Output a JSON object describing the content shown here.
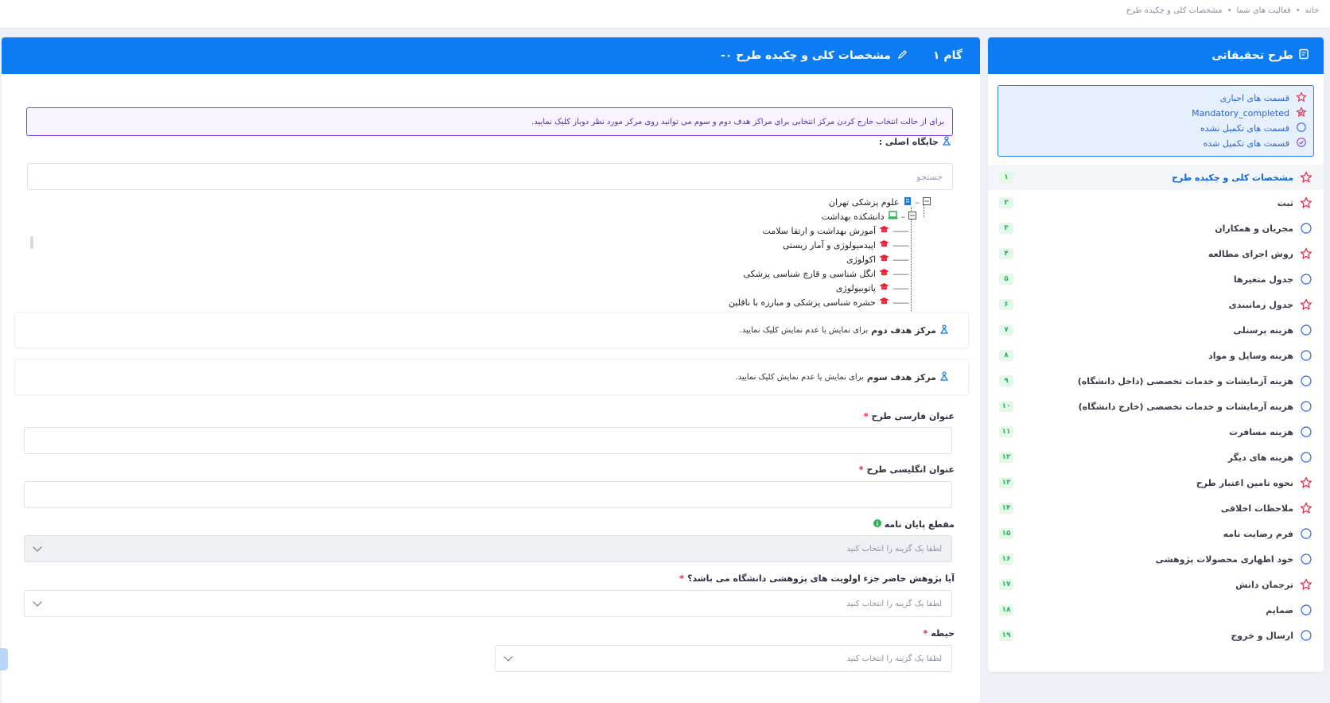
{
  "breadcrumb": [
    "خانه",
    "فعالیت های شما",
    "مشخصات کلی و چکیده طرح"
  ],
  "breadcrumb_sep": "•",
  "sidebar": {
    "title": "طرح تحقیقاتی",
    "legend": [
      {
        "icon": "star-outline-icon",
        "label": "قسمت های اجباری"
      },
      {
        "icon": "star-check-icon",
        "label": "Mandatory_completed"
      },
      {
        "icon": "circle-outline-icon",
        "label": "قسمت های تکمیل نشده"
      },
      {
        "icon": "circle-check-icon",
        "label": "قسمت های تکمیل شده"
      }
    ],
    "steps": [
      {
        "label": "مشخصات کلی و چکیده طرح",
        "num": "۱",
        "icon": "star"
      },
      {
        "label": "ثبت",
        "num": "۲",
        "icon": "star"
      },
      {
        "label": "مجریان و همکاران",
        "num": "۳",
        "icon": "circle"
      },
      {
        "label": "روش اجرای مطالعه",
        "num": "۴",
        "icon": "star"
      },
      {
        "label": "جدول متغیرها",
        "num": "۵",
        "icon": "circle"
      },
      {
        "label": "جدول زمانبندی",
        "num": "۶",
        "icon": "star"
      },
      {
        "label": "هزینه پرسنلی",
        "num": "۷",
        "icon": "circle"
      },
      {
        "label": "هزینه وسایل و مواد",
        "num": "۸",
        "icon": "circle"
      },
      {
        "label": "هزینه آزمایشات و خدمات تخصصی (داخل دانشگاه)",
        "num": "۹",
        "icon": "circle"
      },
      {
        "label": "هزینه آزمایشات و خدمات تخصصی (خارج دانشگاه)",
        "num": "۱۰",
        "icon": "circle"
      },
      {
        "label": "هزینه مسافرت",
        "num": "۱۱",
        "icon": "circle"
      },
      {
        "label": "هزینه های دیگر",
        "num": "۱۲",
        "icon": "circle"
      },
      {
        "label": "نحوه تامین اعتبار طرح",
        "num": "۱۳",
        "icon": "star"
      },
      {
        "label": "ملاحظات اخلاقی",
        "num": "۱۴",
        "icon": "star"
      },
      {
        "label": "فرم رضایت نامه",
        "num": "۱۵",
        "icon": "circle"
      },
      {
        "label": "خود اظهاری محصولات پژوهشی",
        "num": "۱۶",
        "icon": "circle"
      },
      {
        "label": "ترجمان دانش",
        "num": "۱۷",
        "icon": "star"
      },
      {
        "label": "ضمایم",
        "num": "۱۸",
        "icon": "circle"
      },
      {
        "label": "ارسال و خروج",
        "num": "۱۹",
        "icon": "circle"
      }
    ]
  },
  "main": {
    "step_label": "گام ۱",
    "title": "مشخصات کلی و چکیده طرح ۰-",
    "alert": "برای از حالت انتخاب خارج کردن مرکز انتخابی برای مراکز هدف دوم و سوم می توانید روی مرکز مورد نظر دوبار کلیک نمایید.",
    "main_location_label": "جایگاه اصلی :",
    "search_placeholder": "جستجو",
    "tree": {
      "root": "علوم پزشکی تهران",
      "school": "دانشکده بهداشت",
      "departments": [
        "آموزش بهداشت و ارتقا سلامت",
        "اپیدمیولوژی و آمار زیستی",
        "اکولوژی",
        "انگل شناسی و قارچ شناسی پزشکی",
        "پاتوبیولوژی",
        "حشره شناسی پزشکی و مبارزه با ناقلین"
      ]
    },
    "target2": {
      "bold": "مرکز هدف دوم",
      "text": "برای نمایش یا عدم نمایش کلیک نمایید."
    },
    "target3": {
      "bold": "مرکز هدف سوم",
      "text": "برای نمایش یا عدم نمایش کلیک نمایید."
    },
    "fa_title_label": "عنوان فارسی طرح",
    "en_title_label": "عنوان انگلیسی طرح",
    "thesis_label": "مقطع پایان نامه",
    "priority_label": "آیا پژوهش حاضر جزء اولویت های پژوهشی دانشگاه می باشد؟",
    "field_label": "حیطه",
    "select_placeholder": "لطفا یک گزینه را انتخاب کنید",
    "required_mark": "*"
  }
}
